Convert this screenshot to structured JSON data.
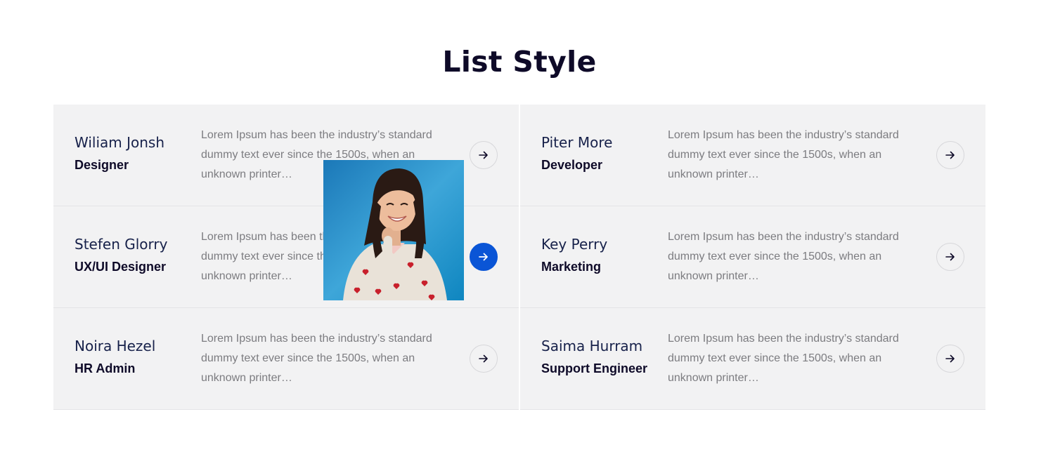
{
  "section": {
    "title": "List Style"
  },
  "team": [
    {
      "name": "Wiliam Jonsh",
      "role": "Designer",
      "description": "Lorem Ipsum has been the industry’s standard dummy text ever since the 1500s, when an unknown printer…",
      "arrow_icon": "arrow-right-icon"
    },
    {
      "name": "Piter More",
      "role": "Developer",
      "description": "Lorem Ipsum has been the industry’s standard dummy text ever since the 1500s, when an unknown printer…",
      "arrow_icon": "arrow-right-icon"
    },
    {
      "name": "Stefen Glorry",
      "role": "UX/UI Designer",
      "description": "Lorem Ipsum has been the industry’s standard dummy text ever since the 1500s, when an unknown printer…",
      "arrow_icon": "arrow-right-icon",
      "active": true
    },
    {
      "name": "Key Perry",
      "role": "Marketing",
      "description": "Lorem Ipsum has been the industry’s standard dummy text ever since the 1500s, when an unknown printer…",
      "arrow_icon": "arrow-right-icon"
    },
    {
      "name": "Noira Hezel",
      "role": "HR Admin",
      "description": "Lorem Ipsum has been the industry’s standard dummy text ever since the 1500s, when an unknown printer…",
      "arrow_icon": "arrow-right-icon"
    },
    {
      "name": "Saima Hurram",
      "role": "Support Engineer",
      "description": "Lorem Ipsum has been the industry’s standard dummy text ever since the 1500s, when an unknown printer…",
      "arrow_icon": "arrow-right-icon"
    }
  ],
  "colors": {
    "title": "#0e0a28",
    "name": "#17214a",
    "card_bg": "#f2f2f3",
    "accent": "#0a55d6",
    "description": "#7c7c80"
  },
  "hover_photo": {
    "subject": "smiling-woman-portrait"
  }
}
